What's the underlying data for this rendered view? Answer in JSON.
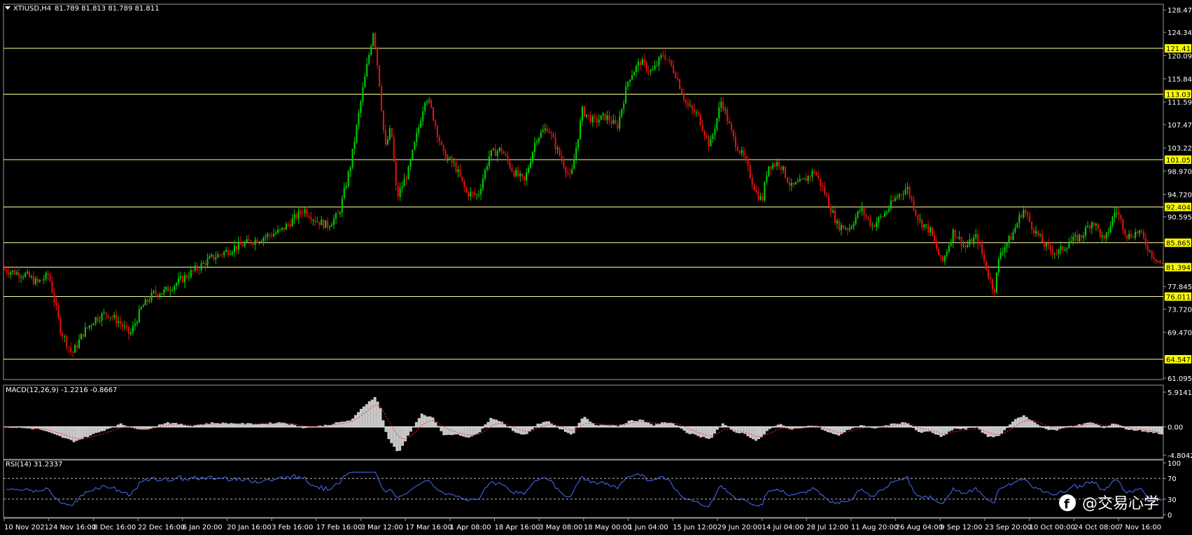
{
  "symbol_label": "XTIUSD,H4",
  "ohlc_label": "81.789 81.813 81.789 81.811",
  "watermark": "@交易心学",
  "colors": {
    "background": "#000000",
    "frame": "#9a9a9a",
    "bull": "#00d000",
    "bear": "#e01010",
    "level_line": "#ffff99",
    "level_tag": "#ffff00",
    "macd_hist": "#c8c8c8",
    "macd_signal": "#ff3030",
    "rsi_line": "#4a6cff",
    "text": "#ffffff"
  },
  "chart_data": {
    "type": "candlestick",
    "price_axis": {
      "ylim": [
        61.095,
        128.47
      ],
      "ticks": [
        "128.470",
        "124.345",
        "120.095",
        "115.845",
        "111.595",
        "107.470",
        "103.220",
        "98.970",
        "94.720",
        "90.595",
        "85.865",
        "81.394",
        "77.845",
        "73.720",
        "69.470",
        "61.095"
      ]
    },
    "levels": [
      "121.418",
      "113.039",
      "101.057",
      "92.404",
      "85.865",
      "81.394",
      "76.011",
      "64.547"
    ],
    "time_labels": [
      "10 Nov 2021",
      "24 Nov 16:00",
      "8 Dec 16:00",
      "22 Dec 16:00",
      "6 Jan 20:00",
      "20 Jan 16:00",
      "3 Feb 16:00",
      "17 Feb 16:00",
      "3 Mar 12:00",
      "17 Mar 16:00",
      "1 Apr 08:00",
      "18 Apr 16:00",
      "3 May 08:00",
      "18 May 00:00",
      "1 Jun 04:00",
      "15 Jun 12:00",
      "29 Jun 20:00",
      "14 Jul 04:00",
      "28 Jul 12:00",
      "11 Aug 20:00",
      "26 Aug 04:00",
      "9 Sep 12:00",
      "23 Sep 20:00",
      "10 Oct 00:00",
      "24 Oct 08:00",
      "7 Nov 16:00"
    ],
    "price_path": [
      [
        0,
        81.0
      ],
      [
        0.02,
        80.0
      ],
      [
        0.03,
        78.5
      ],
      [
        0.04,
        80.0
      ],
      [
        0.05,
        70.0
      ],
      [
        0.06,
        65.5
      ],
      [
        0.07,
        69.5
      ],
      [
        0.08,
        72.0
      ],
      [
        0.09,
        73.0
      ],
      [
        0.1,
        71.5
      ],
      [
        0.11,
        69.0
      ],
      [
        0.12,
        74.0
      ],
      [
        0.13,
        76.5
      ],
      [
        0.14,
        77.0
      ],
      [
        0.16,
        80.0
      ],
      [
        0.18,
        83.0
      ],
      [
        0.2,
        85.0
      ],
      [
        0.22,
        86.5
      ],
      [
        0.24,
        88.0
      ],
      [
        0.26,
        92.0
      ],
      [
        0.27,
        90.0
      ],
      [
        0.28,
        89.0
      ],
      [
        0.29,
        91.0
      ],
      [
        0.3,
        100.0
      ],
      [
        0.31,
        113.0
      ],
      [
        0.315,
        119.0
      ],
      [
        0.32,
        125.0
      ],
      [
        0.325,
        115.0
      ],
      [
        0.33,
        103.0
      ],
      [
        0.335,
        107.0
      ],
      [
        0.34,
        94.0
      ],
      [
        0.35,
        99.0
      ],
      [
        0.36,
        108.0
      ],
      [
        0.365,
        113.0
      ],
      [
        0.37,
        110.0
      ],
      [
        0.38,
        102.0
      ],
      [
        0.39,
        100.0
      ],
      [
        0.4,
        95.0
      ],
      [
        0.41,
        94.5
      ],
      [
        0.42,
        102.0
      ],
      [
        0.43,
        103.0
      ],
      [
        0.44,
        99.0
      ],
      [
        0.45,
        97.0
      ],
      [
        0.46,
        105.0
      ],
      [
        0.47,
        107.0
      ],
      [
        0.48,
        102.0
      ],
      [
        0.49,
        97.5
      ],
      [
        0.5,
        110.0
      ],
      [
        0.51,
        108.0
      ],
      [
        0.52,
        109.0
      ],
      [
        0.53,
        107.0
      ],
      [
        0.54,
        116.0
      ],
      [
        0.55,
        119.0
      ],
      [
        0.56,
        117.0
      ],
      [
        0.57,
        120.5
      ],
      [
        0.58,
        117.0
      ],
      [
        0.59,
        111.0
      ],
      [
        0.6,
        109.0
      ],
      [
        0.61,
        103.5
      ],
      [
        0.62,
        112.0
      ],
      [
        0.63,
        105.0
      ],
      [
        0.64,
        101.0
      ],
      [
        0.65,
        95.0
      ],
      [
        0.655,
        93.5
      ],
      [
        0.66,
        100.0
      ],
      [
        0.67,
        100.5
      ],
      [
        0.68,
        96.0
      ],
      [
        0.69,
        97.0
      ],
      [
        0.7,
        99.0
      ],
      [
        0.71,
        94.5
      ],
      [
        0.72,
        89.0
      ],
      [
        0.73,
        88.5
      ],
      [
        0.74,
        92.0
      ],
      [
        0.75,
        89.0
      ],
      [
        0.76,
        91.0
      ],
      [
        0.77,
        94.0
      ],
      [
        0.78,
        96.0
      ],
      [
        0.79,
        90.0
      ],
      [
        0.8,
        88.0
      ],
      [
        0.81,
        82.0
      ],
      [
        0.82,
        88.0
      ],
      [
        0.83,
        85.0
      ],
      [
        0.84,
        87.0
      ],
      [
        0.85,
        80.0
      ],
      [
        0.855,
        77.0
      ],
      [
        0.86,
        84.0
      ],
      [
        0.87,
        87.0
      ],
      [
        0.88,
        92.0
      ],
      [
        0.89,
        88.0
      ],
      [
        0.9,
        85.0
      ],
      [
        0.91,
        84.0
      ],
      [
        0.92,
        86.0
      ],
      [
        0.93,
        87.0
      ],
      [
        0.94,
        90.0
      ],
      [
        0.95,
        86.0
      ],
      [
        0.96,
        92.0
      ],
      [
        0.97,
        87.0
      ],
      [
        0.98,
        88.0
      ],
      [
        0.99,
        84.0
      ],
      [
        1.0,
        81.8
      ]
    ],
    "macd": {
      "label": "MACD(12,26,9) -1.2216 -0.8667",
      "ylim": [
        -4.8042,
        5.9141
      ],
      "ticks": [
        "5.9141",
        "0.00",
        "-4.8042"
      ],
      "path": [
        [
          0,
          0
        ],
        [
          0.03,
          -0.4
        ],
        [
          0.06,
          -2.5
        ],
        [
          0.08,
          -1.0
        ],
        [
          0.1,
          0.5
        ],
        [
          0.12,
          -0.6
        ],
        [
          0.14,
          0.8
        ],
        [
          0.16,
          0.2
        ],
        [
          0.18,
          0.7
        ],
        [
          0.2,
          0.6
        ],
        [
          0.22,
          0.5
        ],
        [
          0.24,
          0.8
        ],
        [
          0.26,
          -0.2
        ],
        [
          0.28,
          0.4
        ],
        [
          0.3,
          1.2
        ],
        [
          0.31,
          3.5
        ],
        [
          0.32,
          5.2
        ],
        [
          0.325,
          3.0
        ],
        [
          0.33,
          -1.5
        ],
        [
          0.34,
          -4.5
        ],
        [
          0.35,
          -1.0
        ],
        [
          0.36,
          2.2
        ],
        [
          0.37,
          1.5
        ],
        [
          0.38,
          -1.5
        ],
        [
          0.39,
          -1.2
        ],
        [
          0.4,
          -2.0
        ],
        [
          0.41,
          -1.0
        ],
        [
          0.42,
          1.5
        ],
        [
          0.43,
          0.8
        ],
        [
          0.44,
          -0.8
        ],
        [
          0.45,
          -1.5
        ],
        [
          0.46,
          0.5
        ],
        [
          0.47,
          1.0
        ],
        [
          0.48,
          -0.3
        ],
        [
          0.49,
          -1.5
        ],
        [
          0.5,
          1.8
        ],
        [
          0.51,
          0.3
        ],
        [
          0.52,
          0.4
        ],
        [
          0.53,
          0.2
        ],
        [
          0.54,
          1.0
        ],
        [
          0.55,
          1.2
        ],
        [
          0.56,
          0.3
        ],
        [
          0.57,
          0.8
        ],
        [
          0.58,
          0.4
        ],
        [
          0.59,
          -1.0
        ],
        [
          0.6,
          -1.6
        ],
        [
          0.61,
          -2.0
        ],
        [
          0.62,
          0.6
        ],
        [
          0.63,
          -0.8
        ],
        [
          0.64,
          -1.2
        ],
        [
          0.65,
          -2.5
        ],
        [
          0.66,
          -0.5
        ],
        [
          0.67,
          0.5
        ],
        [
          0.68,
          -0.5
        ],
        [
          0.69,
          0.0
        ],
        [
          0.7,
          0.3
        ],
        [
          0.71,
          -0.8
        ],
        [
          0.72,
          -1.5
        ],
        [
          0.73,
          -0.4
        ],
        [
          0.74,
          0.3
        ],
        [
          0.75,
          -0.3
        ],
        [
          0.76,
          0.2
        ],
        [
          0.77,
          0.6
        ],
        [
          0.78,
          0.8
        ],
        [
          0.79,
          -1.0
        ],
        [
          0.8,
          -0.8
        ],
        [
          0.81,
          -1.8
        ],
        [
          0.82,
          -0.3
        ],
        [
          0.83,
          -0.4
        ],
        [
          0.84,
          0.0
        ],
        [
          0.85,
          -1.8
        ],
        [
          0.86,
          -1.5
        ],
        [
          0.87,
          0.8
        ],
        [
          0.88,
          2.0
        ],
        [
          0.89,
          0.8
        ],
        [
          0.9,
          -0.4
        ],
        [
          0.91,
          -0.6
        ],
        [
          0.92,
          0.2
        ],
        [
          0.93,
          0.4
        ],
        [
          0.94,
          0.8
        ],
        [
          0.95,
          -0.2
        ],
        [
          0.96,
          0.7
        ],
        [
          0.97,
          -0.5
        ],
        [
          0.98,
          -0.6
        ],
        [
          0.99,
          -0.9
        ],
        [
          1.0,
          -1.2
        ]
      ]
    },
    "rsi": {
      "label": "RSI(14) 31.2337",
      "ylim": [
        0,
        100
      ],
      "levels": [
        30,
        70
      ],
      "ticks": [
        "100",
        "70",
        "30",
        "0"
      ]
    }
  }
}
